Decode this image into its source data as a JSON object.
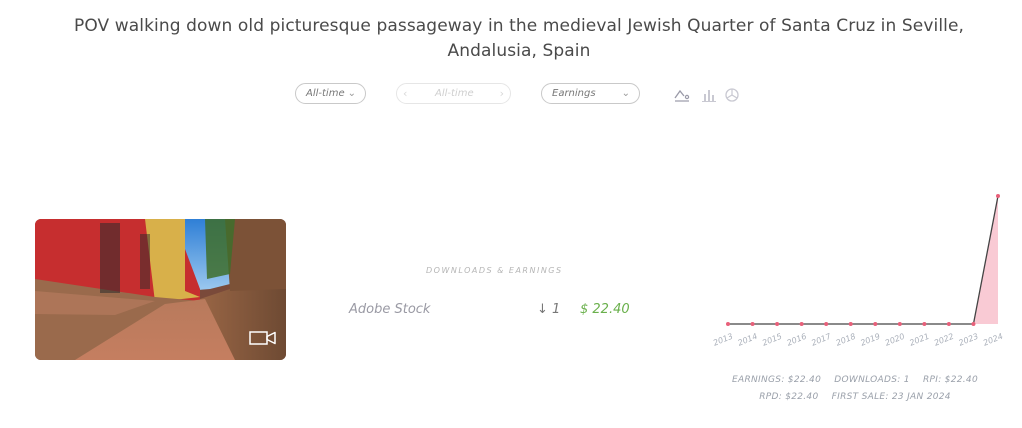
{
  "title": "POV walking down old picturesque passageway in the medieval Jewish Quarter of Santa Cruz in Seville, Andalusia, Spain",
  "filters": {
    "period": "All-time",
    "range": "All-time",
    "metric": "Earnings"
  },
  "icons": {
    "line_chart": "line-chart-icon",
    "bar_chart": "bar-chart-icon",
    "pie_chart": "pie-chart-icon",
    "video": "video-camera-icon"
  },
  "section_label": "DOWNLOADS & EARNINGS",
  "agency": {
    "name": "Adobe Stock",
    "downloads": "↓ 1",
    "earnings": "$ 22.40"
  },
  "chart_data": {
    "type": "area",
    "x": [
      "2013",
      "2014",
      "2015",
      "2016",
      "2017",
      "2018",
      "2019",
      "2020",
      "2021",
      "2022",
      "2023",
      "2024"
    ],
    "values": [
      0,
      0,
      0,
      0,
      0,
      0,
      0,
      0,
      0,
      0,
      0,
      22.4
    ],
    "ylim": [
      0,
      22.4
    ],
    "line_color": "#444444",
    "fill_color": "#f7b8c6",
    "marker_color": "#e8607a"
  },
  "stats": {
    "earnings": "EARNINGS: $22.40",
    "downloads": "DOWNLOADS: 1",
    "rpi": "RPI: $22.40",
    "rpd": "RPD: $22.40",
    "first_sale": "FIRST SALE: 23 JAN 2024"
  }
}
